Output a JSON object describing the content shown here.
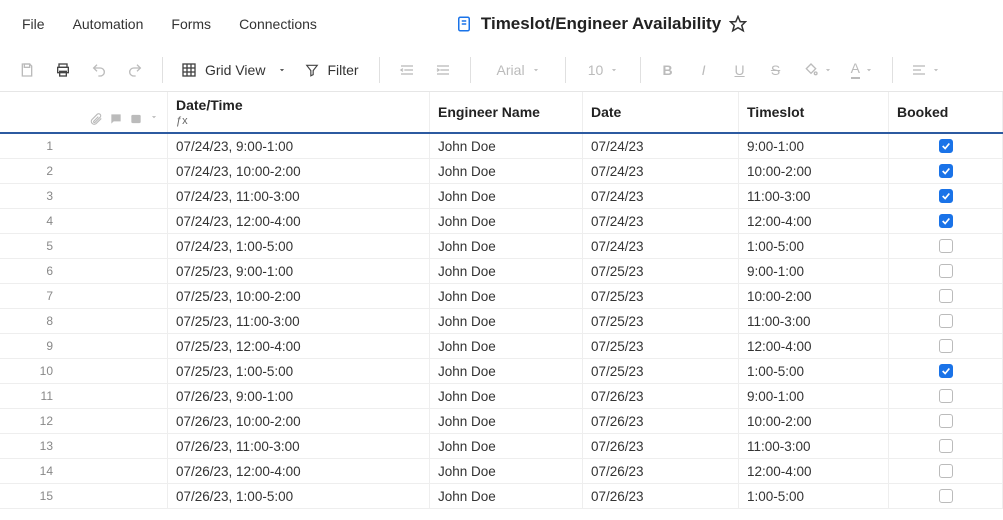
{
  "menu": {
    "file": "File",
    "automation": "Automation",
    "forms": "Forms",
    "connections": "Connections"
  },
  "title": "Timeslot/Engineer Availability",
  "toolbar": {
    "grid_view": "Grid View",
    "filter": "Filter",
    "font": "Arial",
    "font_size": "10"
  },
  "columns": {
    "datetime": "Date/Time",
    "engineer": "Engineer Name",
    "date": "Date",
    "timeslot": "Timeslot",
    "booked": "Booked"
  },
  "rows": [
    {
      "n": "1",
      "dt": "07/24/23, 9:00-1:00",
      "eng": "John Doe",
      "date": "07/24/23",
      "ts": "9:00-1:00",
      "booked": true
    },
    {
      "n": "2",
      "dt": "07/24/23, 10:00-2:00",
      "eng": "John Doe",
      "date": "07/24/23",
      "ts": "10:00-2:00",
      "booked": true
    },
    {
      "n": "3",
      "dt": "07/24/23, 11:00-3:00",
      "eng": "John Doe",
      "date": "07/24/23",
      "ts": "11:00-3:00",
      "booked": true
    },
    {
      "n": "4",
      "dt": "07/24/23, 12:00-4:00",
      "eng": "John Doe",
      "date": "07/24/23",
      "ts": "12:00-4:00",
      "booked": true
    },
    {
      "n": "5",
      "dt": "07/24/23, 1:00-5:00",
      "eng": "John Doe",
      "date": "07/24/23",
      "ts": "1:00-5:00",
      "booked": false
    },
    {
      "n": "6",
      "dt": "07/25/23, 9:00-1:00",
      "eng": "John Doe",
      "date": "07/25/23",
      "ts": "9:00-1:00",
      "booked": false
    },
    {
      "n": "7",
      "dt": "07/25/23, 10:00-2:00",
      "eng": "John Doe",
      "date": "07/25/23",
      "ts": "10:00-2:00",
      "booked": false
    },
    {
      "n": "8",
      "dt": "07/25/23, 11:00-3:00",
      "eng": "John Doe",
      "date": "07/25/23",
      "ts": "11:00-3:00",
      "booked": false
    },
    {
      "n": "9",
      "dt": "07/25/23, 12:00-4:00",
      "eng": "John Doe",
      "date": "07/25/23",
      "ts": "12:00-4:00",
      "booked": false
    },
    {
      "n": "10",
      "dt": "07/25/23, 1:00-5:00",
      "eng": "John Doe",
      "date": "07/25/23",
      "ts": "1:00-5:00",
      "booked": true
    },
    {
      "n": "11",
      "dt": "07/26/23, 9:00-1:00",
      "eng": "John Doe",
      "date": "07/26/23",
      "ts": "9:00-1:00",
      "booked": false
    },
    {
      "n": "12",
      "dt": "07/26/23, 10:00-2:00",
      "eng": "John Doe",
      "date": "07/26/23",
      "ts": "10:00-2:00",
      "booked": false
    },
    {
      "n": "13",
      "dt": "07/26/23, 11:00-3:00",
      "eng": "John Doe",
      "date": "07/26/23",
      "ts": "11:00-3:00",
      "booked": false
    },
    {
      "n": "14",
      "dt": "07/26/23, 12:00-4:00",
      "eng": "John Doe",
      "date": "07/26/23",
      "ts": "12:00-4:00",
      "booked": false
    },
    {
      "n": "15",
      "dt": "07/26/23, 1:00-5:00",
      "eng": "John Doe",
      "date": "07/26/23",
      "ts": "1:00-5:00",
      "booked": false
    }
  ]
}
